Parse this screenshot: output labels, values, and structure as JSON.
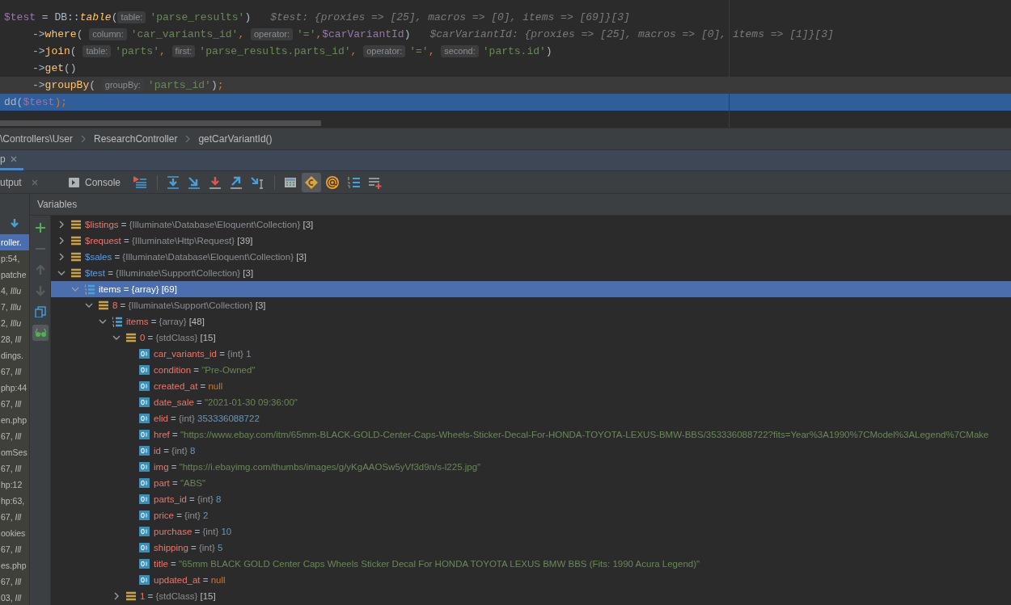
{
  "editor": {
    "lines": [
      {
        "indented": false,
        "current": false,
        "selected": false,
        "segments": [
          {
            "kind": "var",
            "text": "$test"
          },
          {
            "kind": "plain",
            "text": " = DB::"
          },
          {
            "kind": "static",
            "text": "table"
          },
          {
            "kind": "plain",
            "text": "("
          },
          {
            "kind": "hint",
            "text": "table:"
          },
          {
            "kind": "string",
            "text": "'parse_results'"
          },
          {
            "kind": "plain",
            "text": ")"
          },
          {
            "kind": "inline",
            "text": "$test: {proxies => [25], macros => [0], items => [69]}[3]"
          }
        ]
      },
      {
        "indented": true,
        "current": false,
        "selected": false,
        "segments": [
          {
            "kind": "plain",
            "text": "->"
          },
          {
            "kind": "method",
            "text": "where"
          },
          {
            "kind": "plain",
            "text": "( "
          },
          {
            "kind": "hint",
            "text": "column:"
          },
          {
            "kind": "string",
            "text": "'car_variants_id'"
          },
          {
            "kind": "keyword",
            "text": ", "
          },
          {
            "kind": "hint",
            "text": "operator:"
          },
          {
            "kind": "string",
            "text": "'='"
          },
          {
            "kind": "keyword",
            "text": ","
          },
          {
            "kind": "var",
            "text": "$carVariantId"
          },
          {
            "kind": "plain",
            "text": ")"
          },
          {
            "kind": "inline",
            "text": "$carVariantId: {proxies => [25], macros => [0], items => [1]}[3]"
          }
        ]
      },
      {
        "indented": true,
        "current": false,
        "selected": false,
        "segments": [
          {
            "kind": "plain",
            "text": "->"
          },
          {
            "kind": "method",
            "text": "join"
          },
          {
            "kind": "plain",
            "text": "( "
          },
          {
            "kind": "hint",
            "text": "table:"
          },
          {
            "kind": "string",
            "text": "'parts'"
          },
          {
            "kind": "keyword",
            "text": ", "
          },
          {
            "kind": "hint",
            "text": "first:"
          },
          {
            "kind": "string",
            "text": "'parse_results.parts_id'"
          },
          {
            "kind": "keyword",
            "text": ", "
          },
          {
            "kind": "hint",
            "text": "operator:"
          },
          {
            "kind": "string",
            "text": "'='"
          },
          {
            "kind": "keyword",
            "text": ", "
          },
          {
            "kind": "hint",
            "text": "second:"
          },
          {
            "kind": "string",
            "text": "'parts.id'"
          },
          {
            "kind": "plain",
            "text": ")"
          }
        ]
      },
      {
        "indented": true,
        "current": false,
        "selected": false,
        "segments": [
          {
            "kind": "plain",
            "text": "->"
          },
          {
            "kind": "method",
            "text": "get"
          },
          {
            "kind": "plain",
            "text": "()"
          }
        ]
      },
      {
        "indented": true,
        "current": true,
        "selected": false,
        "segments": [
          {
            "kind": "plain",
            "text": "->"
          },
          {
            "kind": "method",
            "text": "groupBy"
          },
          {
            "kind": "plain",
            "text": "( "
          },
          {
            "kind": "hint",
            "text": "groupBy:"
          },
          {
            "kind": "string",
            "text": "'parts_id'"
          },
          {
            "kind": "plain",
            "text": ")"
          },
          {
            "kind": "keyword",
            "text": ";"
          }
        ]
      },
      {
        "indented": false,
        "current": false,
        "selected": true,
        "segments": [
          {
            "kind": "plain",
            "text": "dd("
          },
          {
            "kind": "var",
            "text": "$test"
          },
          {
            "kind": "keyword",
            "text": ");"
          }
        ]
      }
    ]
  },
  "breadcrumbs": [
    "\\Controllers\\User",
    "ResearchController",
    "getCarVariantId()"
  ],
  "debug_tabs": [
    {
      "label": "p",
      "selected": true
    }
  ],
  "toolbar": {
    "output_tab": "utput",
    "console_tab": "Console"
  },
  "frames": [
    {
      "text": "roller.",
      "selected": true
    },
    {
      "text": "p:54,",
      "selected": false
    },
    {
      "text": "patche",
      "selected": false
    },
    {
      "text": "4, *Illu*",
      "selected": false
    },
    {
      "text": "7, *Illu*",
      "selected": false
    },
    {
      "text": "2, *Illu*",
      "selected": false
    },
    {
      "text": "28, *Ill*",
      "selected": false
    },
    {
      "text": "dings.",
      "selected": false
    },
    {
      "text": "67, *Ill*",
      "selected": false
    },
    {
      "text": "php:44",
      "selected": false
    },
    {
      "text": "67, *Ill*",
      "selected": false
    },
    {
      "text": "en.php",
      "selected": false
    },
    {
      "text": "67, *Ill*",
      "selected": false
    },
    {
      "text": "omSes",
      "selected": false
    },
    {
      "text": "67, *Ill*",
      "selected": false
    },
    {
      "text": "hp:12",
      "selected": false
    },
    {
      "text": "hp:63,",
      "selected": false
    },
    {
      "text": "67, *Ill*",
      "selected": false
    },
    {
      "text": "ookies",
      "selected": false
    },
    {
      "text": "67, *Ill*",
      "selected": false
    },
    {
      "text": "es.php",
      "selected": false
    },
    {
      "text": "67, *Ill*",
      "selected": false
    },
    {
      "text": "03, *Ill*",
      "selected": false
    }
  ],
  "variables_header": "Variables",
  "variables": [
    {
      "kind": "object",
      "name": "$listings",
      "equals": "=",
      "changed": false,
      "type": "{Illuminate\\Database\\Eloquent\\Collection}",
      "count": "[3]",
      "expanded": false,
      "selected": false
    },
    {
      "kind": "object",
      "name": "$request",
      "equals": "=",
      "changed": false,
      "type": "{Illuminate\\Http\\Request}",
      "count": "[39]",
      "expanded": false,
      "selected": false
    },
    {
      "kind": "object",
      "name": "$sales",
      "equals": "=",
      "changed": true,
      "type": "{Illuminate\\Database\\Eloquent\\Collection}",
      "count": "[3]",
      "expanded": false,
      "selected": false
    },
    {
      "kind": "object",
      "name": "$test",
      "equals": "=",
      "changed": true,
      "type": "{Illuminate\\Support\\Collection}",
      "count": "[3]",
      "expanded": true,
      "selected": false,
      "children": [
        {
          "kind": "array",
          "name": "items",
          "equals": "=",
          "changed": false,
          "type": "{array}",
          "count": "[69]",
          "expanded": true,
          "selected": true,
          "children": [
            {
              "kind": "object",
              "name": "8",
              "equals": "=",
              "changed": false,
              "type": "{Illuminate\\Support\\Collection}",
              "count": "[3]",
              "expanded": true,
              "selected": false,
              "children": [
                {
                  "kind": "array",
                  "name": "items",
                  "equals": "=",
                  "changed": false,
                  "type": "{array}",
                  "count": "[48]",
                  "expanded": true,
                  "selected": false,
                  "children": [
                    {
                      "kind": "object",
                      "name": "0",
                      "equals": "=",
                      "changed": false,
                      "type": "{stdClass}",
                      "count": "[15]",
                      "expanded": true,
                      "selected": false,
                      "children": [
                        {
                          "kind": "field",
                          "name": "car_variants_id",
                          "equals": "=",
                          "changed": false,
                          "type": "{int}",
                          "value": {
                            "kind": "number",
                            "text": "1"
                          },
                          "selected": false
                        },
                        {
                          "kind": "field",
                          "name": "condition",
                          "equals": "=",
                          "changed": false,
                          "value": {
                            "kind": "string",
                            "text": "\"Pre-Owned\""
                          },
                          "selected": false
                        },
                        {
                          "kind": "field",
                          "name": "created_at",
                          "equals": "=",
                          "changed": false,
                          "value": {
                            "kind": "null",
                            "text": "null"
                          },
                          "selected": false
                        },
                        {
                          "kind": "field",
                          "name": "date_sale",
                          "equals": "=",
                          "changed": false,
                          "value": {
                            "kind": "string",
                            "text": "\"2021-01-30 09:36:00\""
                          },
                          "selected": false
                        },
                        {
                          "kind": "field",
                          "name": "elid",
                          "equals": "=",
                          "changed": false,
                          "type": "{int}",
                          "value": {
                            "kind": "number",
                            "text": "353336088722"
                          },
                          "selected": false
                        },
                        {
                          "kind": "field",
                          "name": "href",
                          "equals": "=",
                          "changed": false,
                          "value": {
                            "kind": "string",
                            "text": "\"https://www.ebay.com/itm/65mm-BLACK-GOLD-Center-Caps-Wheels-Sticker-Decal-For-HONDA-TOYOTA-LEXUS-BMW-BBS/353336088722?fits=Year%3A1990%7CModel%3ALegend%7CMake"
                          },
                          "selected": false
                        },
                        {
                          "kind": "field",
                          "name": "id",
                          "equals": "=",
                          "changed": false,
                          "type": "{int}",
                          "value": {
                            "kind": "number",
                            "text": "8"
                          },
                          "selected": false
                        },
                        {
                          "kind": "field",
                          "name": "img",
                          "equals": "=",
                          "changed": false,
                          "value": {
                            "kind": "string",
                            "text": "\"https://i.ebayimg.com/thumbs/images/g/yKgAAOSw5yVf3d9n/s-l225.jpg\""
                          },
                          "selected": false
                        },
                        {
                          "kind": "field",
                          "name": "part",
                          "equals": "=",
                          "changed": false,
                          "value": {
                            "kind": "string",
                            "text": "\"ABS\""
                          },
                          "selected": false
                        },
                        {
                          "kind": "field",
                          "name": "parts_id",
                          "equals": "=",
                          "changed": false,
                          "type": "{int}",
                          "value": {
                            "kind": "number",
                            "text": "8"
                          },
                          "selected": false
                        },
                        {
                          "kind": "field",
                          "name": "price",
                          "equals": "=",
                          "changed": false,
                          "type": "{int}",
                          "value": {
                            "kind": "number",
                            "text": "2"
                          },
                          "selected": false
                        },
                        {
                          "kind": "field",
                          "name": "purchase",
                          "equals": "=",
                          "changed": false,
                          "type": "{int}",
                          "value": {
                            "kind": "number",
                            "text": "10"
                          },
                          "selected": false
                        },
                        {
                          "kind": "field",
                          "name": "shipping",
                          "equals": "=",
                          "changed": false,
                          "type": "{int}",
                          "value": {
                            "kind": "number",
                            "text": "5"
                          },
                          "selected": false
                        },
                        {
                          "kind": "field",
                          "name": "title",
                          "equals": "=",
                          "changed": false,
                          "value": {
                            "kind": "string",
                            "text": "\"65mm BLACK GOLD Center Caps Wheels Sticker Decal For HONDA TOYOTA LEXUS BMW BBS (Fits: 1990 Acura Legend)\""
                          },
                          "selected": false
                        },
                        {
                          "kind": "field",
                          "name": "updated_at",
                          "equals": "=",
                          "changed": false,
                          "value": {
                            "kind": "null",
                            "text": "null"
                          },
                          "selected": false
                        }
                      ]
                    },
                    {
                      "kind": "object",
                      "name": "1",
                      "equals": "=",
                      "changed": false,
                      "type": "{stdClass}",
                      "count": "[15]",
                      "expanded": false,
                      "selected": false
                    }
                  ]
                }
              ]
            }
          ]
        }
      ]
    }
  ]
}
